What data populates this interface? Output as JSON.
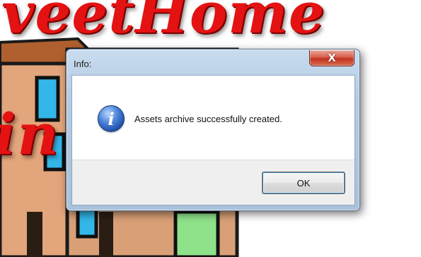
{
  "background": {
    "splash_top": "veetHome",
    "splash_mid": "in                  re"
  },
  "dialog": {
    "title": "Info:",
    "close_label": "X",
    "message": "Assets archive successfully created.",
    "ok_label": "OK",
    "icon": "info-icon"
  },
  "colors": {
    "splash_red": "#e41212",
    "title_bar": "#b4cbe3",
    "close_button": "#c3321f",
    "info_blue": "#1f4fa8"
  }
}
